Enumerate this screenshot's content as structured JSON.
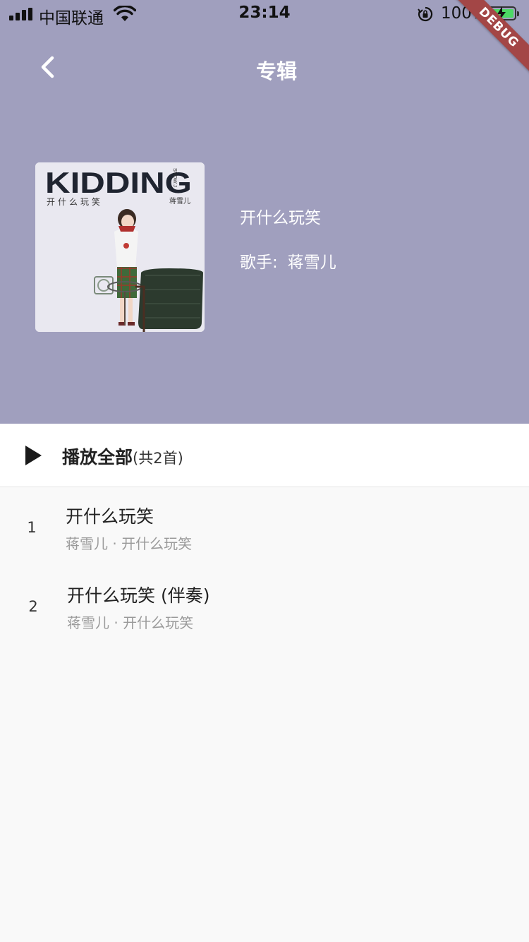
{
  "status_bar": {
    "carrier": "中国联通",
    "time": "23:14",
    "battery_percent": "100%"
  },
  "debug_banner": "DEBUG",
  "nav": {
    "title": "专辑",
    "back_icon": "chevron-left-icon"
  },
  "album": {
    "name": "开什么玩笑",
    "artist_label": "歌手:",
    "artist_name": "蒋雪儿",
    "cover_text": {
      "title": "KIDDING",
      "subtitle": "开什么玩笑",
      "artist_cn": "蒋雪儿",
      "artist_en": "SNOW.J"
    }
  },
  "play_all": {
    "label": "播放全部",
    "count": "(共2首)"
  },
  "songs": [
    {
      "index": "1",
      "title": "开什么玩笑",
      "subtitle": "蒋雪儿 · 开什么玩笑"
    },
    {
      "index": "2",
      "title": "开什么玩笑 (伴奏)",
      "subtitle": "蒋雪儿 · 开什么玩笑"
    }
  ],
  "colors": {
    "header_bg": "#a09fbe",
    "page_bg": "#f9f9f9",
    "debug_ribbon": "#a34646"
  }
}
